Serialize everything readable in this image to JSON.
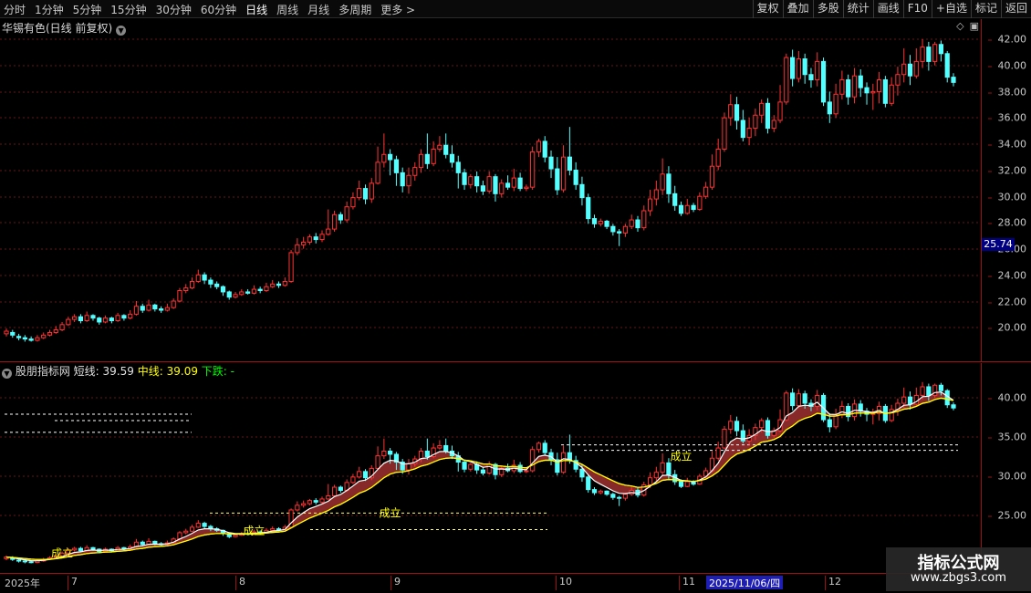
{
  "toolbar": {
    "periods": [
      "分时",
      "1分钟",
      "5分钟",
      "15分钟",
      "30分钟",
      "60分钟",
      "日线",
      "周线",
      "月线",
      "多周期",
      "更多 >"
    ],
    "tools": [
      "复权",
      "叠加",
      "多股",
      "统计",
      "画线",
      "F10",
      "+自选",
      "标记",
      "返回"
    ]
  },
  "main_pane": {
    "title": "华锡有色(日线 前复权)",
    "dropdown_icon": "chevron-down-icon",
    "icons": [
      "diamond-icon",
      "window-restore-icon"
    ],
    "y_ticks": [
      "42.00",
      "40.00",
      "38.00",
      "36.00",
      "34.00",
      "32.00",
      "30.00",
      "28.00",
      "26.00",
      "24.00",
      "22.00",
      "20.00"
    ],
    "current_price": "25.74"
  },
  "indicator_pane": {
    "name": "股朋指标网",
    "short_label": "短线:",
    "short_value": "39.59",
    "mid_label": "中线:",
    "mid_value": "39.09",
    "down_label": "下跌:",
    "down_value": "-",
    "y_ticks": [
      "40.00",
      "35.00",
      "30.00",
      "25.00"
    ],
    "annotations": [
      "成立",
      "成立",
      "成立",
      "成立"
    ]
  },
  "x_axis": {
    "labels": [
      "2025年",
      "7",
      "8",
      "9",
      "10",
      "11",
      "12"
    ],
    "cursor_date": "2025/11/06/四"
  },
  "watermark": {
    "title": "指标公式网",
    "url": "www.zbgs3.com"
  },
  "colors": {
    "up": "#ff3232",
    "down": "#54ffff",
    "short_line": "#ffffff",
    "mid_line": "#ffff00",
    "band": "#a03030",
    "accent_axis": "#a01010"
  },
  "chart_data": {
    "type": "candlestick",
    "title": "华锡有色(日线 前复权)",
    "ylim": [
      18.5,
      43.0
    ],
    "candles": [
      [
        19.5,
        19.7,
        19.9,
        19.3
      ],
      [
        19.6,
        19.4,
        19.8,
        19.2
      ],
      [
        19.3,
        19.2,
        19.5,
        19.0
      ],
      [
        19.2,
        19.1,
        19.4,
        18.9
      ],
      [
        19.1,
        19.0,
        19.3,
        18.9
      ],
      [
        19.0,
        19.2,
        19.4,
        18.9
      ],
      [
        19.2,
        19.4,
        19.6,
        19.1
      ],
      [
        19.4,
        19.6,
        19.8,
        19.3
      ],
      [
        19.6,
        19.8,
        20.1,
        19.5
      ],
      [
        19.8,
        20.2,
        20.4,
        19.7
      ],
      [
        20.2,
        20.6,
        20.8,
        20.1
      ],
      [
        20.6,
        20.8,
        21.0,
        20.4
      ],
      [
        20.8,
        20.5,
        21.0,
        20.3
      ],
      [
        20.5,
        20.9,
        21.2,
        20.4
      ],
      [
        20.9,
        20.7,
        21.0,
        20.5
      ],
      [
        20.7,
        20.4,
        20.8,
        20.2
      ],
      [
        20.4,
        20.7,
        20.9,
        20.3
      ],
      [
        20.7,
        20.5,
        20.8,
        20.3
      ],
      [
        20.5,
        20.9,
        21.1,
        20.4
      ],
      [
        20.9,
        20.7,
        21.0,
        20.5
      ],
      [
        20.7,
        21.0,
        21.3,
        20.6
      ],
      [
        21.0,
        21.6,
        22.0,
        20.9
      ],
      [
        21.6,
        21.3,
        21.8,
        21.1
      ],
      [
        21.3,
        21.7,
        22.1,
        21.2
      ],
      [
        21.7,
        21.4,
        21.8,
        21.2
      ],
      [
        21.4,
        21.3,
        21.6,
        21.1
      ],
      [
        21.3,
        21.5,
        21.8,
        21.2
      ],
      [
        21.5,
        22.0,
        22.2,
        21.4
      ],
      [
        22.0,
        22.8,
        23.0,
        21.9
      ],
      [
        22.8,
        23.0,
        23.3,
        22.6
      ],
      [
        23.0,
        23.5,
        23.8,
        22.9
      ],
      [
        23.5,
        24.0,
        24.4,
        23.4
      ],
      [
        24.0,
        23.6,
        24.2,
        23.3
      ],
      [
        23.6,
        23.3,
        23.8,
        23.0
      ],
      [
        23.3,
        23.1,
        23.5,
        22.9
      ],
      [
        23.1,
        22.7,
        23.2,
        22.4
      ],
      [
        22.7,
        22.3,
        22.8,
        22.1
      ],
      [
        22.3,
        22.5,
        22.7,
        22.2
      ],
      [
        22.5,
        22.7,
        22.9,
        22.4
      ],
      [
        22.7,
        22.6,
        22.9,
        22.5
      ],
      [
        22.6,
        22.9,
        23.2,
        22.5
      ],
      [
        22.9,
        22.8,
        23.1,
        22.6
      ],
      [
        22.8,
        23.1,
        23.4,
        22.7
      ],
      [
        23.1,
        23.3,
        23.6,
        23.0
      ],
      [
        23.3,
        23.2,
        23.5,
        23.0
      ],
      [
        23.2,
        23.5,
        23.8,
        23.1
      ],
      [
        23.5,
        25.7,
        25.9,
        23.4
      ],
      [
        25.7,
        26.3,
        26.8,
        25.5
      ],
      [
        26.3,
        26.5,
        26.9,
        26.0
      ],
      [
        26.5,
        26.9,
        27.1,
        26.3
      ],
      [
        26.9,
        26.7,
        27.2,
        26.4
      ],
      [
        26.7,
        27.1,
        27.4,
        26.5
      ],
      [
        27.1,
        27.5,
        29.0,
        27.0
      ],
      [
        27.5,
        28.6,
        28.9,
        27.3
      ],
      [
        28.6,
        28.2,
        28.8,
        27.9
      ],
      [
        28.2,
        29.2,
        29.6,
        28.0
      ],
      [
        29.2,
        29.9,
        30.3,
        29.0
      ],
      [
        29.9,
        30.6,
        31.2,
        29.7
      ],
      [
        30.6,
        29.8,
        30.9,
        29.4
      ],
      [
        29.8,
        31.0,
        31.4,
        29.5
      ],
      [
        31.0,
        32.6,
        33.8,
        30.9
      ],
      [
        32.6,
        33.2,
        34.8,
        32.2
      ],
      [
        33.2,
        32.8,
        33.6,
        31.6
      ],
      [
        32.8,
        31.8,
        33.1,
        30.8
      ],
      [
        31.8,
        30.8,
        32.2,
        30.3
      ],
      [
        30.8,
        31.6,
        32.2,
        30.2
      ],
      [
        31.6,
        32.2,
        32.6,
        31.2
      ],
      [
        32.2,
        33.2,
        33.6,
        31.8
      ],
      [
        33.2,
        32.5,
        34.8,
        32.1
      ],
      [
        32.5,
        33.6,
        34.2,
        32.3
      ],
      [
        33.6,
        33.9,
        34.6,
        33.4
      ],
      [
        33.9,
        33.2,
        34.8,
        32.9
      ],
      [
        33.2,
        32.6,
        33.9,
        32.2
      ],
      [
        32.6,
        31.8,
        33.1,
        30.6
      ],
      [
        31.8,
        30.9,
        32.1,
        30.5
      ],
      [
        30.9,
        31.5,
        31.7,
        30.6
      ],
      [
        31.5,
        30.8,
        31.9,
        30.3
      ],
      [
        30.8,
        30.4,
        31.2,
        30.1
      ],
      [
        30.4,
        31.5,
        31.9,
        30.2
      ],
      [
        31.5,
        30.2,
        31.7,
        29.6
      ],
      [
        30.2,
        31.0,
        31.3,
        29.9
      ],
      [
        31.0,
        30.7,
        31.6,
        30.5
      ],
      [
        30.7,
        31.4,
        32.1,
        30.4
      ],
      [
        31.4,
        30.6,
        31.8,
        30.4
      ],
      [
        30.6,
        30.7,
        30.9,
        30.4
      ],
      [
        30.7,
        33.4,
        33.8,
        30.5
      ],
      [
        33.4,
        34.2,
        34.4,
        33.0
      ],
      [
        34.2,
        33.0,
        34.6,
        32.6
      ],
      [
        33.0,
        32.1,
        33.5,
        31.4
      ],
      [
        32.1,
        30.5,
        33.0,
        30.1
      ],
      [
        30.5,
        33.0,
        33.9,
        30.3
      ],
      [
        33.0,
        32.0,
        35.3,
        31.6
      ],
      [
        32.0,
        30.9,
        32.6,
        30.5
      ],
      [
        30.9,
        29.9,
        31.5,
        29.3
      ],
      [
        29.9,
        28.3,
        30.2,
        27.9
      ],
      [
        28.3,
        27.9,
        28.6,
        27.6
      ],
      [
        27.9,
        28.1,
        28.3,
        27.7
      ],
      [
        28.1,
        27.7,
        28.2,
        27.5
      ],
      [
        27.7,
        27.3,
        27.9,
        27.0
      ],
      [
        27.3,
        27.2,
        27.5,
        26.2
      ],
      [
        27.2,
        27.7,
        27.9,
        26.9
      ],
      [
        27.7,
        28.2,
        28.6,
        27.5
      ],
      [
        28.2,
        27.6,
        28.5,
        27.3
      ],
      [
        27.6,
        28.9,
        29.3,
        27.4
      ],
      [
        28.9,
        29.8,
        30.5,
        28.5
      ],
      [
        29.8,
        30.5,
        31.2,
        29.3
      ],
      [
        30.5,
        31.7,
        32.9,
        30.1
      ],
      [
        31.7,
        30.2,
        32.3,
        29.5
      ],
      [
        30.2,
        29.3,
        30.8,
        28.9
      ],
      [
        29.3,
        28.7,
        29.6,
        28.5
      ],
      [
        28.7,
        29.3,
        29.8,
        28.6
      ],
      [
        29.3,
        29.0,
        29.5,
        28.8
      ],
      [
        29.0,
        30.0,
        30.3,
        28.9
      ],
      [
        30.0,
        30.7,
        31.1,
        29.8
      ],
      [
        30.7,
        32.3,
        33.2,
        30.5
      ],
      [
        32.3,
        33.6,
        34.4,
        32.0
      ],
      [
        33.6,
        36.0,
        36.4,
        33.4
      ],
      [
        36.0,
        37.0,
        37.8,
        35.4
      ],
      [
        37.0,
        35.8,
        37.6,
        35.1
      ],
      [
        35.8,
        34.5,
        36.6,
        34.2
      ],
      [
        34.5,
        35.2,
        36.0,
        33.9
      ],
      [
        35.2,
        36.2,
        36.7,
        34.6
      ],
      [
        36.2,
        37.1,
        37.4,
        35.6
      ],
      [
        37.1,
        35.2,
        37.5,
        34.8
      ],
      [
        35.2,
        35.8,
        36.2,
        34.9
      ],
      [
        35.8,
        37.2,
        38.5,
        35.6
      ],
      [
        37.2,
        40.6,
        40.9,
        37.0
      ],
      [
        40.6,
        39.0,
        41.2,
        38.4
      ],
      [
        39.0,
        40.5,
        41.1,
        38.7
      ],
      [
        40.5,
        39.3,
        40.9,
        38.6
      ],
      [
        39.3,
        38.9,
        39.8,
        38.3
      ],
      [
        38.9,
        40.3,
        41.0,
        38.4
      ],
      [
        40.3,
        37.2,
        40.6,
        36.9
      ],
      [
        37.2,
        36.3,
        38.0,
        35.6
      ],
      [
        36.3,
        37.8,
        38.6,
        36.0
      ],
      [
        37.8,
        38.9,
        39.6,
        37.4
      ],
      [
        38.9,
        37.6,
        39.3,
        37.0
      ],
      [
        37.6,
        39.2,
        39.8,
        37.1
      ],
      [
        39.2,
        38.3,
        39.7,
        37.6
      ],
      [
        38.3,
        37.9,
        38.7,
        37.0
      ],
      [
        37.9,
        38.0,
        38.6,
        36.6
      ],
      [
        38.0,
        38.9,
        39.5,
        37.1
      ],
      [
        38.9,
        37.1,
        39.2,
        36.8
      ],
      [
        37.1,
        38.5,
        39.1,
        36.9
      ],
      [
        38.5,
        39.3,
        39.9,
        37.7
      ],
      [
        39.3,
        40.1,
        41.3,
        38.7
      ],
      [
        40.1,
        39.2,
        40.8,
        38.5
      ],
      [
        39.2,
        40.3,
        41.3,
        39.0
      ],
      [
        40.3,
        41.4,
        42.0,
        39.8
      ],
      [
        41.4,
        40.3,
        41.8,
        39.6
      ],
      [
        40.3,
        41.6,
        41.8,
        40.0
      ],
      [
        41.6,
        40.9,
        41.9,
        40.3
      ],
      [
        40.9,
        39.1,
        41.1,
        38.7
      ],
      [
        39.1,
        38.7,
        39.4,
        38.4
      ]
    ]
  }
}
